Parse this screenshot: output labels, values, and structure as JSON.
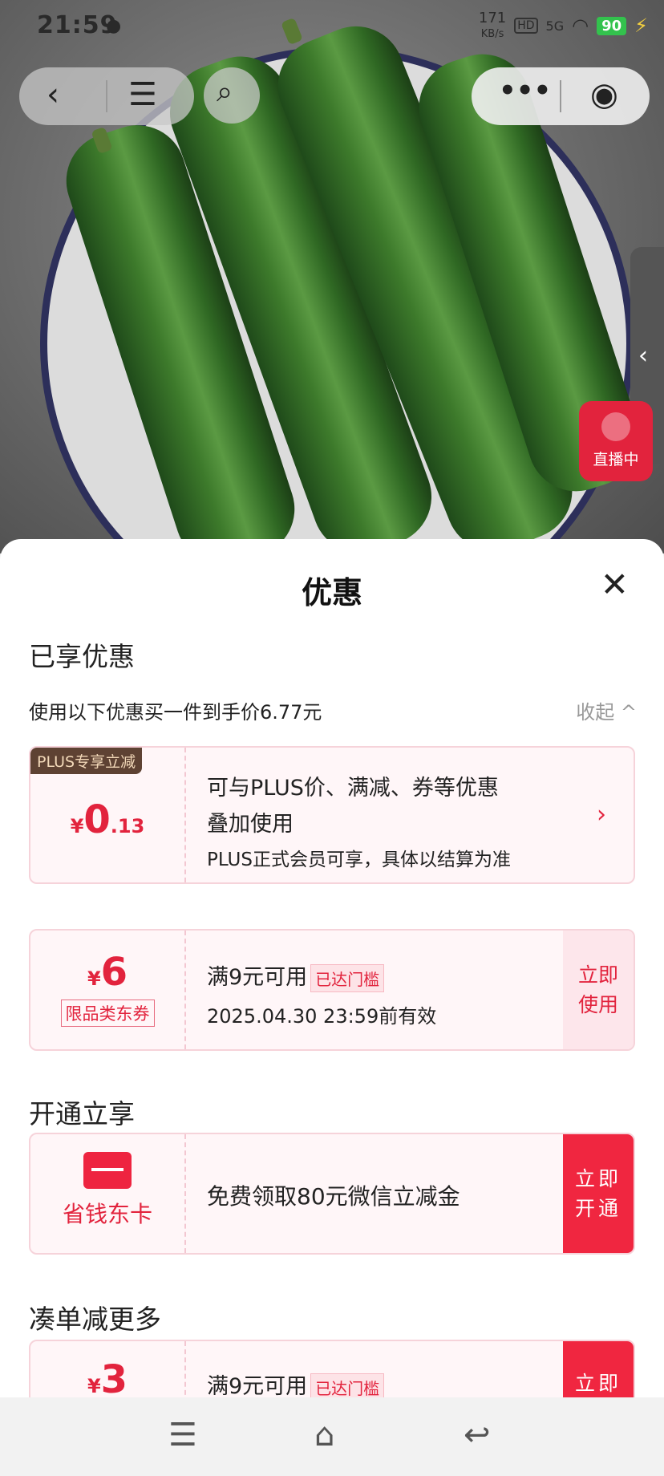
{
  "status_bar": {
    "time": "21:59",
    "net_speed": "171",
    "net_unit": "KB/s",
    "hd": "HD",
    "signal": "5G",
    "battery": "90"
  },
  "live": {
    "label": "直播中"
  },
  "sheet": {
    "title": "优惠",
    "enjoyed_heading": "已享优惠",
    "summary": "使用以下优惠买一件到手价6.77元",
    "collapse_label": "收起"
  },
  "plus_card": {
    "tag": "PLUS专享立减",
    "currency": "¥",
    "amount_int": "0",
    "amount_dec": ".13",
    "line1": "可与PLUS价、满减、券等优惠",
    "line2": "叠加使用",
    "line3": "PLUS正式会员可享，具体以结算为准"
  },
  "coupon_card": {
    "currency": "¥",
    "amount": "6",
    "type_label": "限品类东券",
    "condition": "满9元可用",
    "threshold_label": "已达门槛",
    "expiry": "2025.04.30 23:59前有效",
    "action_line1": "立即",
    "action_line2": "使用"
  },
  "open_heading": "开通立享",
  "card_offer": {
    "name": "省钱东卡",
    "description": "免费领取80元微信立减金",
    "action_line1": "立即",
    "action_line2": "开通"
  },
  "more_heading": "凑单减更多",
  "coupon_card_2": {
    "currency": "¥",
    "amount": "3",
    "condition": "满9元可用",
    "threshold_label": "已达门槛",
    "action_line1": "立即"
  },
  "colors": {
    "accent": "#e2233d",
    "plus_tag_bg": "#5e4233"
  }
}
